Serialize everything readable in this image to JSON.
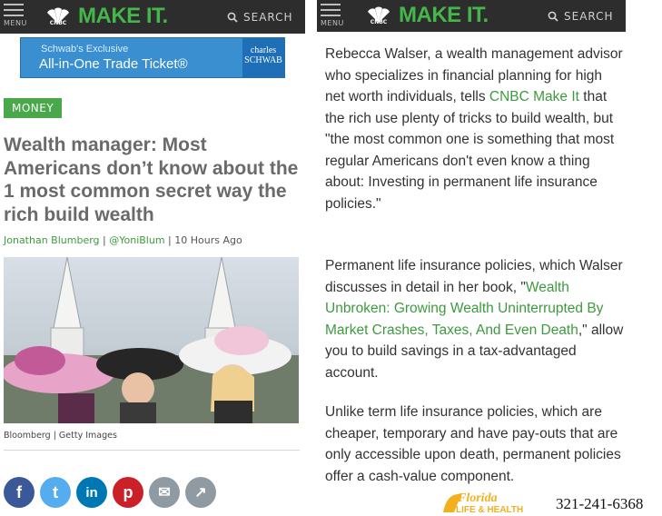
{
  "header": {
    "menu_label": "MENU",
    "brand": "MAKE IT.",
    "network": "CNBC",
    "search_label": "SEARCH"
  },
  "ad": {
    "line1": "Schwab's Exclusive",
    "line2": "All-in-One Trade Ticket®",
    "sponsor_line1": "charles",
    "sponsor_line2": "SCHWAB"
  },
  "article": {
    "section": "MONEY",
    "headline": "Wealth manager: Most Americans don’t know about the 1 most common secret way the rich build wealth",
    "author": "Jonathan Blumberg",
    "handle": "@YoniBlum",
    "time": "10 Hours Ago",
    "photo_credit": "Bloomberg | Getty Images"
  },
  "share": [
    {
      "icon": "facebook-icon",
      "glyph": "f",
      "color": "#3b5998"
    },
    {
      "icon": "twitter-icon",
      "glyph": "t",
      "color": "#55acee"
    },
    {
      "icon": "linkedin-icon",
      "glyph": "in",
      "color": "#0077b5"
    },
    {
      "icon": "pinterest-icon",
      "glyph": "p",
      "color": "#cb2027"
    },
    {
      "icon": "email-icon",
      "glyph": "✉",
      "color": "#8f9aa3"
    },
    {
      "icon": "share-icon",
      "glyph": "↗",
      "color": "#8f9aa3"
    }
  ],
  "body": {
    "p1_a": "Rebecca Walser, a wealth management advisor who specializes in financial planning for high net worth individuals, tells ",
    "p1_link": "CNBC Make It",
    "p1_b": " that the rich use plenty of tricks to build wealth, but \"the most common one is something that most regular Americans don't even know a thing about: Investing in permanent life insurance policies.\"",
    "p2_a": "Permanent life insurance policies, which Walser discusses in detail in her book, \"",
    "p2_link": "Wealth Unbroken: Growing Wealth Uninterrupted By Market Crashes, Taxes, And Even Death",
    "p2_b": ",\" allow you to build savings in a tax-advantaged account.",
    "p3": "Unlike term life insurance policies, which are cheaper, temporary and have pay-outs that are only accessible upon death, permanent policies offer a cash-value component."
  },
  "footer": {
    "logo_text1": "Florida",
    "logo_text2": "LIFE & HEALTH",
    "phone": "321-241-6368"
  },
  "colors": {
    "header_bg": "#2d2d2d",
    "brand_green": "#45b649",
    "link_green": "#3e9a3f"
  }
}
